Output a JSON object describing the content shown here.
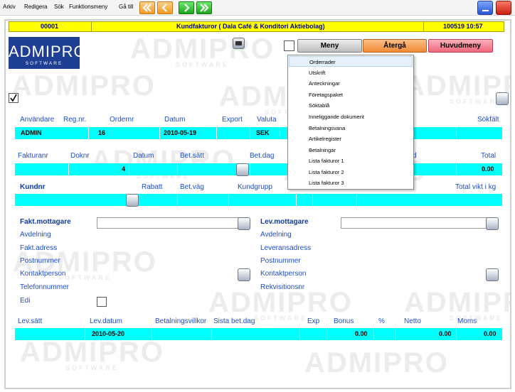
{
  "menubar": {
    "items": [
      "Arkiv",
      "Redigera",
      "Sök",
      "Funktionsmeny",
      "Gå till"
    ],
    "icons": [
      "first-icon",
      "previous-icon",
      "next-icon",
      "last-icon"
    ]
  },
  "header": {
    "record_no": "00001",
    "title": "Kundfakturor ( Dala Café & Konditori Aktiebolag)",
    "datetime": "100519 10:57"
  },
  "logo": {
    "main": "ADMIPRO",
    "sub": "SOFTWARE"
  },
  "watermark": {
    "main": "ADMIPRO",
    "sub": "SOFTWARE"
  },
  "buttons": {
    "meny": "Meny",
    "atergå": "Återgå",
    "huvudmeny": "Huvudmeny"
  },
  "dropdown": {
    "items": [
      "Orderrader",
      "Utskrift",
      "Anteckningar",
      "Företagspaket",
      "Söktablå",
      "Inneliggande dokument",
      "Betalningsvana",
      "Artikelregister",
      "Betalningar",
      "Lista fakturor 1",
      "Lista fakturor 2",
      "Lista fakturor 3"
    ],
    "selected": "Orderrader"
  },
  "row1": {
    "labels": {
      "user": "Användare",
      "regnr": "Reg.nr.",
      "ordernr": "Ordernr",
      "datum": "Datum",
      "export": "Export",
      "valuta": "Valuta",
      "sokfalt": "Sökfält"
    },
    "values": {
      "user": "ADMIN",
      "regnr": "16",
      "datum": "2010-05-19",
      "valuta": "SEK"
    }
  },
  "row2": {
    "labels": {
      "fakturanr": "Fakturanr",
      "doknr": "Doknr",
      "datum": "Datum",
      "betsatt": "Bet.sätt",
      "betdag": "Bet.dag",
      "d": "d",
      "total": "Total"
    },
    "values": {
      "doknr": "4",
      "total": "0.00"
    }
  },
  "row3": {
    "labels": {
      "kundnr": "Kundnr",
      "rabatt": "Rabatt",
      "betvag": "Bet.väg",
      "kundgrupp": "Kundgrupp",
      "totalvikt": "Total vikt i kg"
    }
  },
  "recipients": {
    "fakt": {
      "title": "Fakt.mottagare",
      "avdelning": "Avdelning",
      "adress": "Fakt.adress",
      "postnummer": "Postnummer",
      "kontakt": "Kontaktperson",
      "telefon": "Telefonnummer",
      "edi": "Edi"
    },
    "lev": {
      "title": "Lev.mottagare",
      "avdelning": "Avdelning",
      "adress": "Leveransadress",
      "postnummer": "Postnummer",
      "kontakt": "Kontaktperson",
      "rekv": "Rekvisitionsnr"
    }
  },
  "bottom": {
    "labels": {
      "levsatt": "Lev.sätt",
      "levdatum": "Lev.datum",
      "villkor": "Betalningsvillkor",
      "sistabetdag": "Sista bet.dag",
      "exp": "Exp",
      "bonus": "Bonus",
      "pct": "%",
      "netto": "Netto",
      "moms": "Moms"
    },
    "values": {
      "levdatum": "2010-05-20",
      "bonus": "0.00",
      "netto": "0.00",
      "moms": "0.00"
    }
  },
  "colors": {
    "cyan": "#00ffff",
    "yellow": "#ffff00",
    "logo_bg": "#1e3f93",
    "label_blue": "#1d4dcf",
    "atergå": "#f7a35a",
    "huvudmeny": "#f78c9a"
  }
}
